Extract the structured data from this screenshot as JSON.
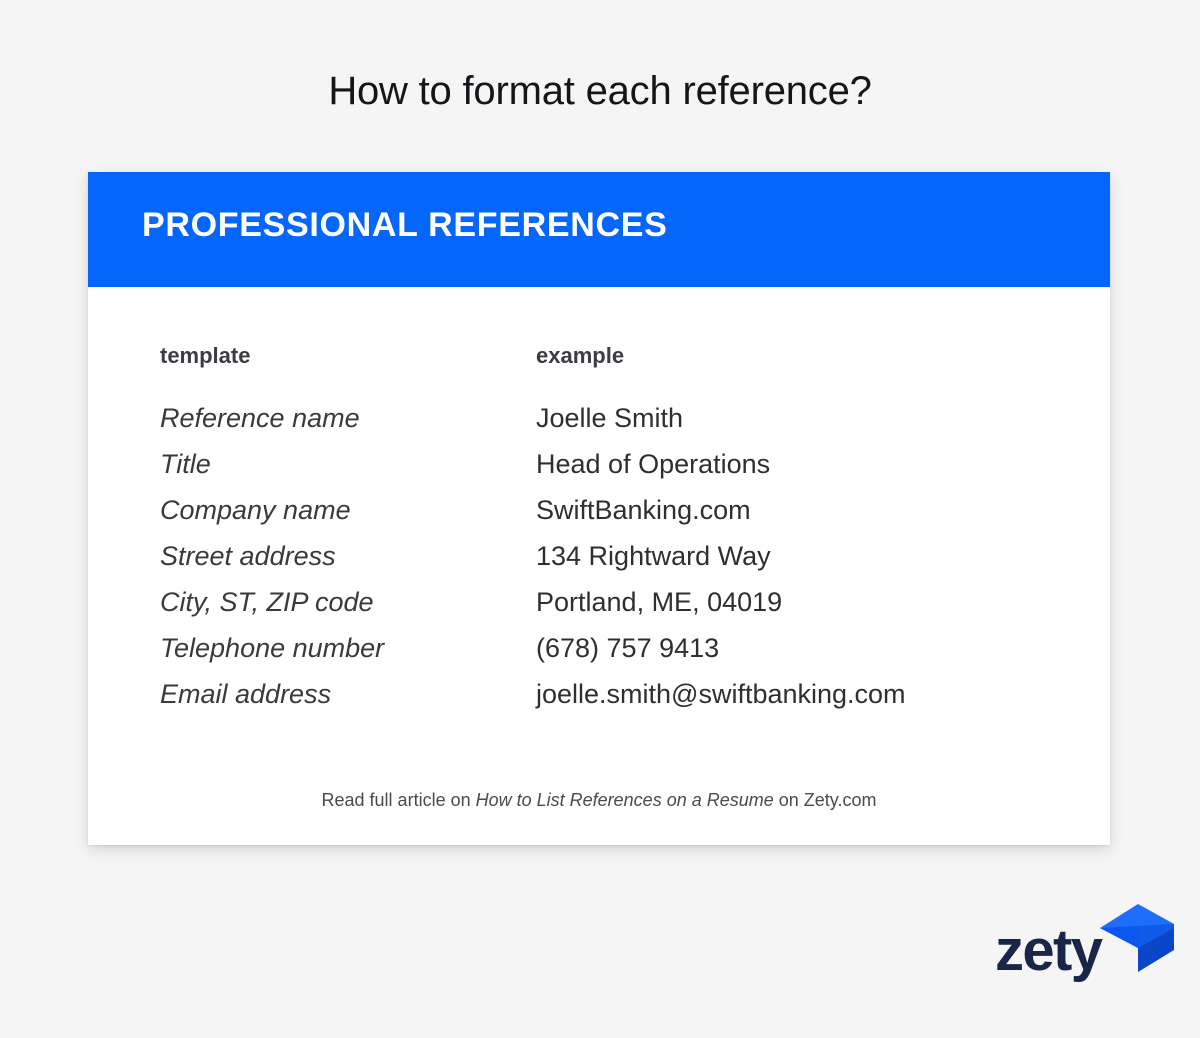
{
  "page": {
    "title": "How to format each reference?",
    "background_color": "#f5f5f5"
  },
  "card": {
    "header": {
      "title": "PROFESSIONAL REFERENCES",
      "background_color": "#0566fb",
      "text_color": "#ffffff"
    },
    "columns": {
      "template_label": "template",
      "example_label": "example"
    },
    "rows": [
      {
        "template": "Reference name",
        "example": "Joelle Smith"
      },
      {
        "template": "Title",
        "example": "Head of Operations"
      },
      {
        "template": "Company name",
        "example": "SwiftBanking.com"
      },
      {
        "template": "Street address",
        "example": "134 Rightward Way"
      },
      {
        "template": "City, ST, ZIP code",
        "example": "Portland, ME, 04019"
      },
      {
        "template": "Telephone number",
        "example": "(678) 757 9413"
      },
      {
        "template": "Email address",
        "example": "joelle.smith@swiftbanking.com"
      }
    ],
    "footnote": {
      "prefix": "Read full article on ",
      "article_title": "How to List References on a Resume",
      "suffix": " on Zety.com"
    }
  },
  "logo": {
    "wordmark": "zety",
    "mark_name": "zety-cube-icon",
    "wordmark_color": "#192647",
    "mark_color_light": "#1f6dfb",
    "mark_color_mid": "#0a58f0",
    "mark_color_dark": "#0b46c8"
  }
}
